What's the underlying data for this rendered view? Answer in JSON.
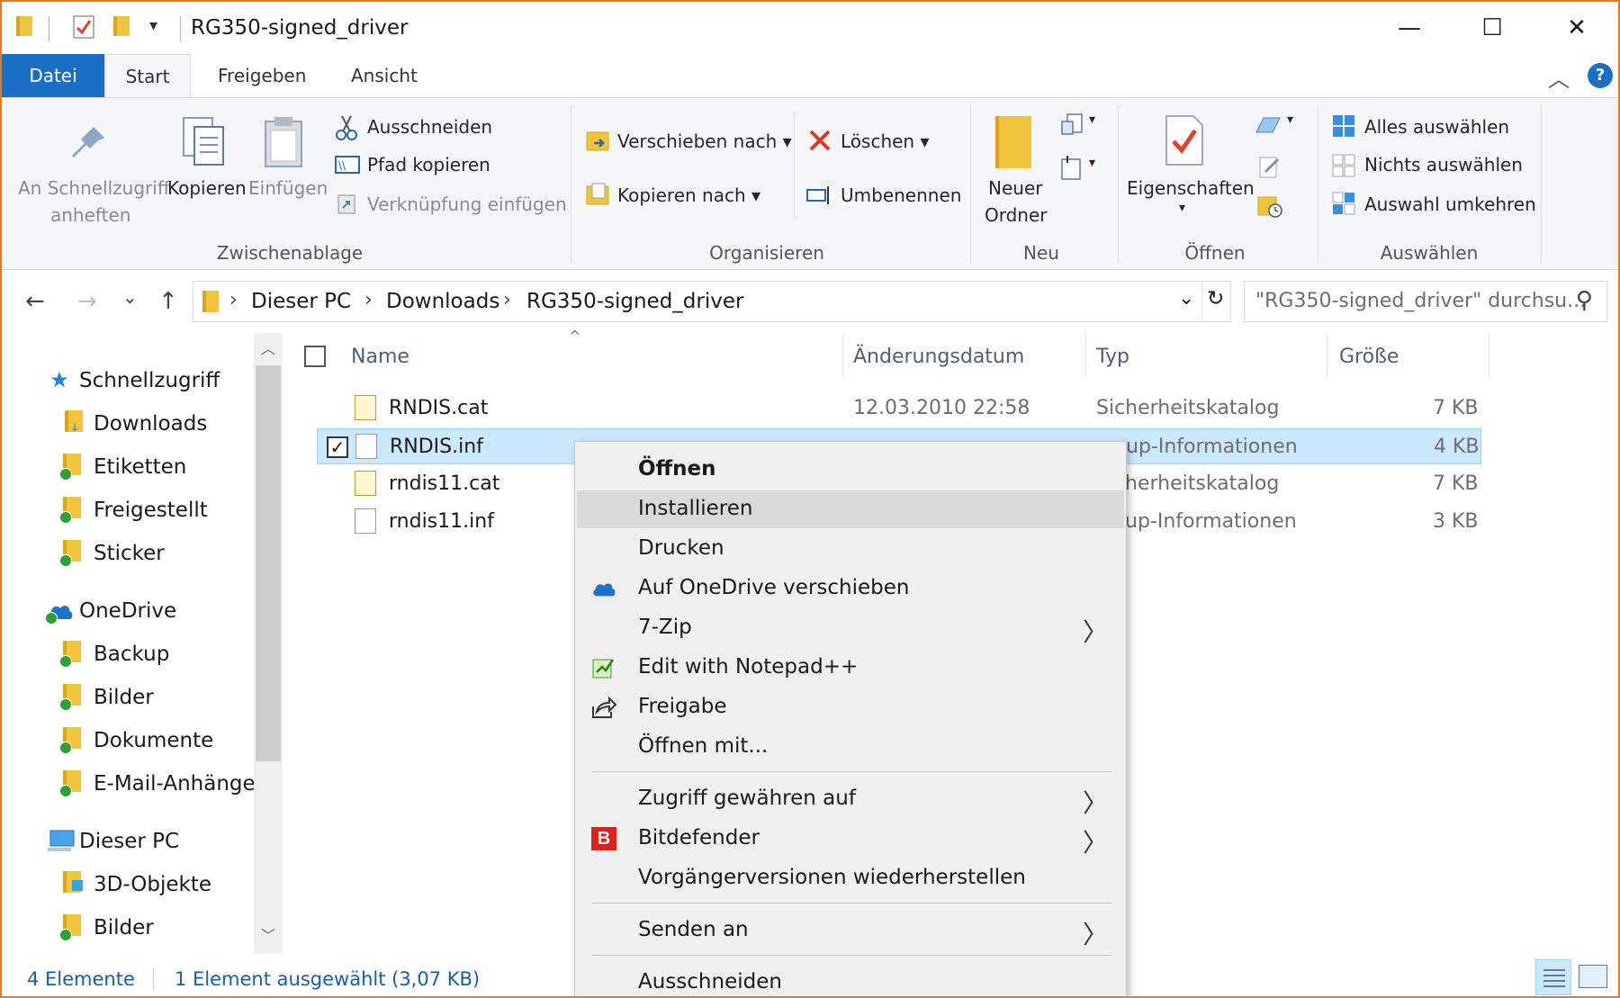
{
  "window": {
    "title": "RG350-signed_driver",
    "minimize_glyph": "—",
    "maximize_glyph": "☐",
    "close_glyph": "✕",
    "qa_dropdown_glyph": "▾"
  },
  "tabs": [
    {
      "label": "Datei"
    },
    {
      "label": "Start"
    },
    {
      "label": "Freigeben"
    },
    {
      "label": "Ansicht"
    }
  ],
  "ribbon": {
    "collapse_glyph": "︿",
    "help_glyph": "?",
    "clipboard": {
      "pin_line1": "An Schnellzugriff",
      "pin_line2": "anheften",
      "copy": "Kopieren",
      "paste": "Einfügen",
      "cut": "Ausschneiden",
      "copy_path": "Pfad kopieren",
      "paste_shortcut": "Verknüpfung einfügen",
      "group": "Zwischenablage"
    },
    "organize": {
      "move_to": "Verschieben nach",
      "copy_to": "Kopieren nach",
      "delete": "Löschen",
      "rename": "Umbenennen",
      "group": "Organisieren"
    },
    "new": {
      "new_folder_line1": "Neuer",
      "new_folder_line2": "Ordner",
      "group": "Neu"
    },
    "open": {
      "properties": "Eigenschaften",
      "group": "Öffnen"
    },
    "select": {
      "select_all": "Alles auswählen",
      "select_none": "Nichts auswählen",
      "invert": "Auswahl umkehren",
      "group": "Auswählen"
    }
  },
  "address": {
    "back": "←",
    "forward": "→",
    "recent": "⌄",
    "up": "↑",
    "crumbs": [
      "Dieser PC",
      "Downloads",
      "RG350-signed_driver"
    ],
    "separator": "›",
    "dropdown": "⌄",
    "refresh": "↻",
    "search_placeholder": "\"RG350-signed_driver\" durchsu...",
    "search_icon": "⚲"
  },
  "nav": {
    "items": [
      {
        "label": "Schnellzugriff"
      },
      {
        "label": "Downloads"
      },
      {
        "label": "Etiketten"
      },
      {
        "label": "Freigestellt"
      },
      {
        "label": "Sticker"
      },
      {
        "label": "OneDrive"
      },
      {
        "label": "Backup"
      },
      {
        "label": "Bilder"
      },
      {
        "label": "Dokumente"
      },
      {
        "label": "E-Mail-Anhänge"
      },
      {
        "label": "Dieser PC"
      },
      {
        "label": "3D-Objekte"
      },
      {
        "label": "Bilder"
      }
    ],
    "scroll_up": "︿",
    "scroll_down": "﹀"
  },
  "columns": {
    "sort_glyph": "^",
    "name": "Name",
    "date": "Änderungsdatum",
    "type": "Typ",
    "size": "Größe"
  },
  "files": [
    {
      "name": "RNDIS.cat",
      "date": "12.03.2010 22:58",
      "type": "Sicherheitskatalog",
      "size": "7 KB"
    },
    {
      "name": "RNDIS.inf",
      "date": "",
      "type": "up-Informationen",
      "size": "4 KB"
    },
    {
      "name": "rndis11.cat",
      "date": "",
      "type": "herheitskatalog",
      "size": "7 KB"
    },
    {
      "name": "rndis11.inf",
      "date": "",
      "type": "up-Informationen",
      "size": "3 KB"
    }
  ],
  "checkmark": "✓",
  "status": {
    "count": "4 Elemente",
    "selection": "1 Element ausgewählt (3,07 KB)"
  },
  "menu": {
    "items": [
      {
        "label": "Öffnen"
      },
      {
        "label": "Installieren"
      },
      {
        "label": "Drucken"
      },
      {
        "label": "Auf OneDrive verschieben"
      },
      {
        "label": "7-Zip"
      },
      {
        "label": "Edit with Notepad++"
      },
      {
        "label": "Freigabe"
      },
      {
        "label": "Öffnen mit..."
      },
      {
        "label": "Zugriff gewähren auf"
      },
      {
        "label": "Bitdefender"
      },
      {
        "label": "Vorgängerversionen wiederherstellen"
      },
      {
        "label": "Senden an"
      },
      {
        "label": "Ausschneiden"
      }
    ],
    "submenu_arrow": "〉",
    "bitdefender_letter": "B"
  },
  "colors": {
    "accent": "#1a6fc4",
    "window_border": "#e8791f",
    "selection": "#cce8ff",
    "folder": "#f0c53c"
  }
}
